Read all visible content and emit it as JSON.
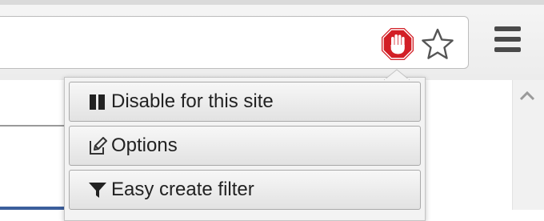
{
  "toolbar": {
    "adblock_icon": "adblock-stop-hand-icon",
    "bookmark_icon": "star-icon",
    "menu_icon": "hamburger-menu-icon",
    "adblock_color": "#d21f26"
  },
  "popup": {
    "items": [
      {
        "label": "Disable for this site",
        "icon": "pause-icon"
      },
      {
        "label": "Options",
        "icon": "edit-icon"
      },
      {
        "label": "Easy create filter",
        "icon": "filter-icon"
      }
    ]
  }
}
